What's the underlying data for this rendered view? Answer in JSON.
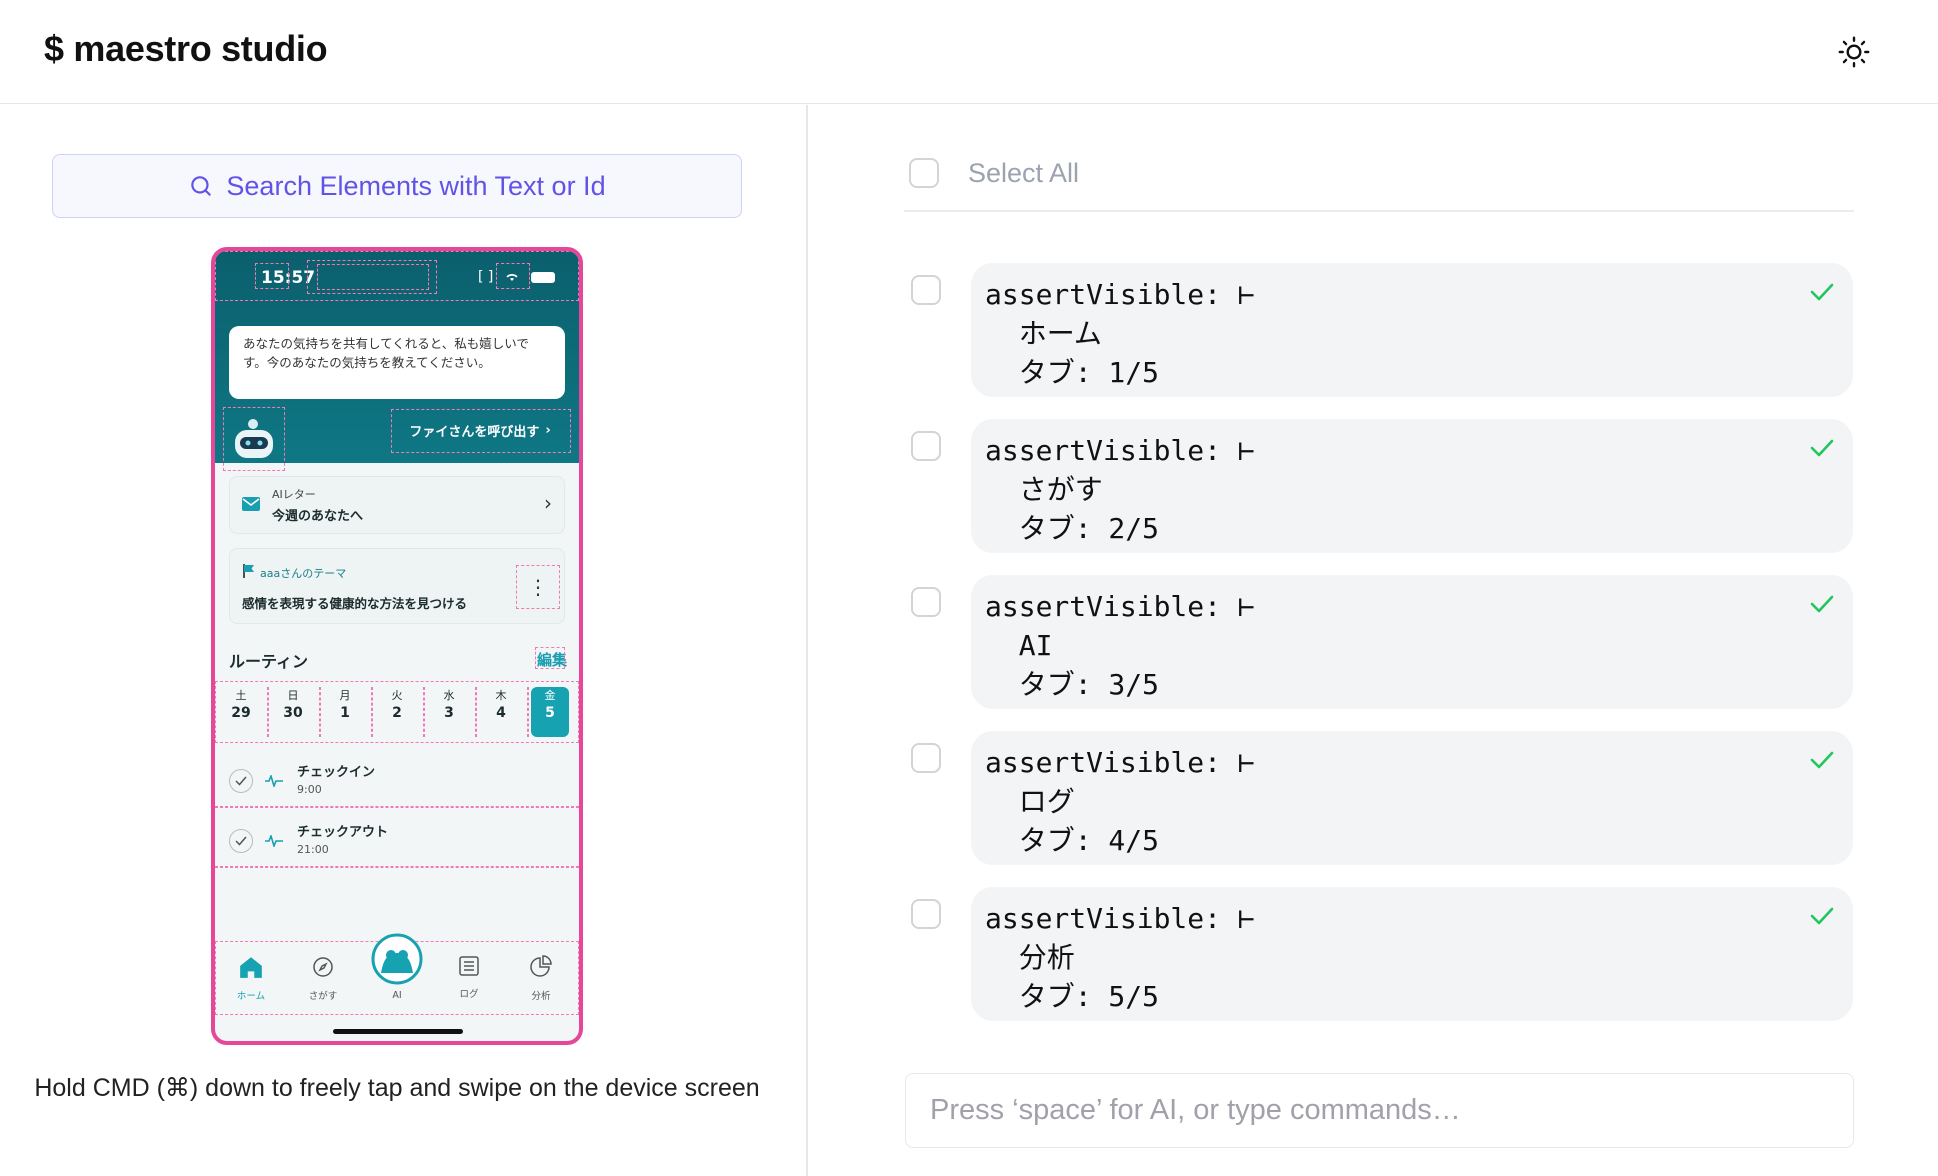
{
  "header": {
    "brand": "$ maestro studio",
    "theme_icon": "sun-icon"
  },
  "search": {
    "label": "Search Elements with Text or Id",
    "icon": "search-icon"
  },
  "device": {
    "status_time": "15:57",
    "bubble_text": "あなたの気持ちを共有してくれると、私も嬉しいです。今のあなたの気持ちを教えてください。",
    "call_button": "ファイさんを呼び出す",
    "ai_letter": {
      "label": "AIレター",
      "title": "今週のあなたへ"
    },
    "theme": {
      "label": "aaaさんのテーマ",
      "title": "感情を表現する健康的な方法を見つける"
    },
    "routine": {
      "title": "ルーティン",
      "edit": "編集"
    },
    "days": [
      {
        "w": "土",
        "d": "29"
      },
      {
        "w": "日",
        "d": "30"
      },
      {
        "w": "月",
        "d": "1"
      },
      {
        "w": "火",
        "d": "2"
      },
      {
        "w": "水",
        "d": "3"
      },
      {
        "w": "木",
        "d": "4"
      },
      {
        "w": "金",
        "d": "5"
      }
    ],
    "tasks": [
      {
        "name": "チェックイン",
        "time": "9:00"
      },
      {
        "name": "チェックアウト",
        "time": "21:00"
      }
    ],
    "tabs": [
      {
        "label": "ホーム",
        "icon": "home-icon"
      },
      {
        "label": "さがす",
        "icon": "compass-icon"
      },
      {
        "label": "AI",
        "icon": "ai-avatar-icon"
      },
      {
        "label": "ログ",
        "icon": "list-icon"
      },
      {
        "label": "分析",
        "icon": "pie-chart-icon"
      }
    ]
  },
  "hint": "Hold CMD (⌘) down to freely tap and swipe on the device screen",
  "select_all": "Select All",
  "commands": [
    {
      "text": "assertVisible: ⊢\n  ホーム\n  タブ: 1/5"
    },
    {
      "text": "assertVisible: ⊢\n  さがす\n  タブ: 2/5"
    },
    {
      "text": "assertVisible: ⊢\n  AI\n  タブ: 3/5"
    },
    {
      "text": "assertVisible: ⊢\n  ログ\n  タブ: 4/5"
    },
    {
      "text": "assertVisible: ⊢\n  分析\n  タブ: 5/5"
    }
  ],
  "command_input": {
    "placeholder": "Press ‘space’ for AI, or type commands…"
  },
  "colors": {
    "accent": "#6153e6",
    "device_border": "#e6479a",
    "teal": "#17a2b2",
    "success": "#22c55e"
  }
}
